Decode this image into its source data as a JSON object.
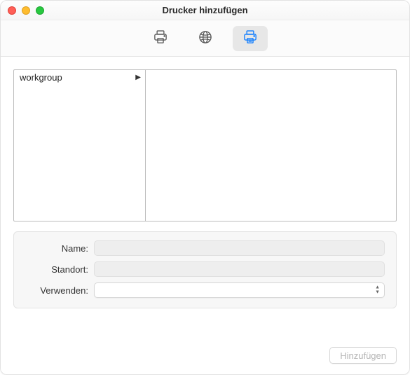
{
  "window": {
    "title": "Drucker hinzufügen"
  },
  "toolbar": {
    "tabs": [
      {
        "id": "default-printer",
        "selected": false
      },
      {
        "id": "ip-printer",
        "selected": false
      },
      {
        "id": "windows-printer",
        "selected": true
      }
    ]
  },
  "browser": {
    "columns": [
      {
        "items": [
          {
            "label": "workgroup",
            "has_children": true
          }
        ]
      },
      {
        "items": []
      }
    ]
  },
  "form": {
    "name_label": "Name:",
    "name_value": "",
    "location_label": "Standort:",
    "location_value": "",
    "use_label": "Verwenden:",
    "use_value": ""
  },
  "footer": {
    "add_label": "Hinzufügen",
    "add_enabled": false
  }
}
